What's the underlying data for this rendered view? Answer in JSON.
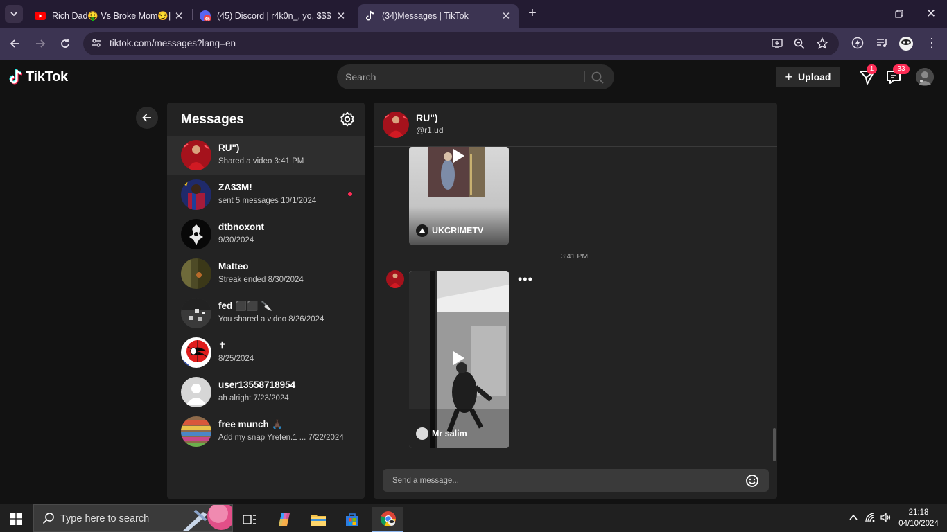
{
  "browser": {
    "tabs": [
      {
        "title": "Rich Dad🤑 Vs Broke Mom😏|",
        "favicon": "youtube-icon",
        "color": "#ff0000"
      },
      {
        "title": "(45) Discord | r4k0n_, yo, $$$",
        "favicon": "discord-icon",
        "badge": "45",
        "color": "#5865f2"
      },
      {
        "title": "(34)Messages | TikTok",
        "favicon": "tiktok-icon",
        "active": true
      }
    ],
    "url": "tiktok.com/messages?lang=en"
  },
  "tiktok": {
    "logo_text": "TikTok",
    "search_placeholder": "Search",
    "upload_label": "Upload",
    "inbox_badge": "1",
    "messages_badge": "33",
    "accent": "#fe2c55"
  },
  "inbox": {
    "title": "Messages",
    "conversations": [
      {
        "name": "RU\")",
        "preview": "Shared a video 3:41 PM",
        "selected": true
      },
      {
        "name": "ZA33M!",
        "preview": "sent 5 messages 10/1/2024",
        "unread": true
      },
      {
        "name": "dtbnoxont",
        "preview": " 9/30/2024"
      },
      {
        "name": "Matteo",
        "preview": "Streak ended 8/30/2024"
      },
      {
        "name": "fed ⬛⬛ 🔪",
        "preview": "You shared a video 8/26/2024"
      },
      {
        "name": "✝",
        "preview": " 8/25/2024"
      },
      {
        "name": "user13558718954",
        "preview": "ah alright 7/23/2024"
      },
      {
        "name": "free munch 🙏🏿",
        "preview": "Add my snap Yrefen.1 ... 7/22/2024"
      }
    ]
  },
  "chat": {
    "name": "RU\")",
    "username": "@r1.ud",
    "videos": [
      {
        "author": "UKCRIMETV"
      },
      {
        "author": "Mr salim"
      }
    ],
    "timestamp": "3:41 PM",
    "more_label": "•••",
    "input_placeholder": "Send a message..."
  },
  "taskbar": {
    "search_placeholder": "Type here to search",
    "time": "21:18",
    "date": "04/10/2024"
  }
}
